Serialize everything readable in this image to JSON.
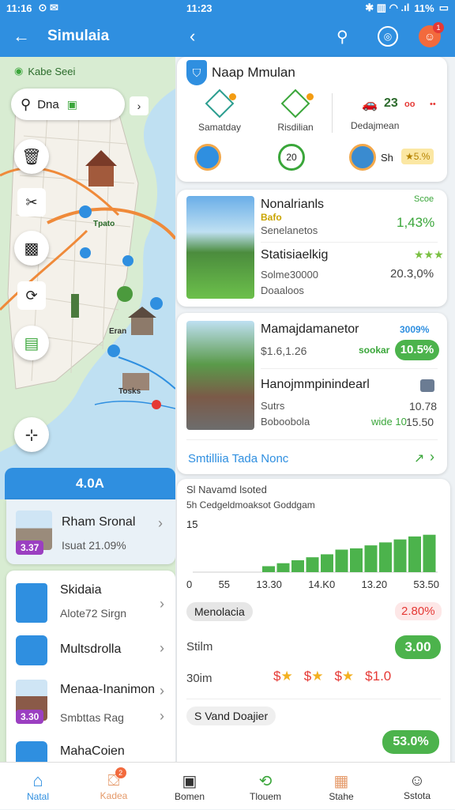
{
  "left": {
    "status_time": "11:16",
    "status_icons": "⊙ ✉",
    "title": "Simulaia",
    "map_label": "Kabe Seei",
    "search_chip": "Dna",
    "search_chip_icon": "▣",
    "map_tags": [
      "Tpato",
      "Eran",
      "Tosks"
    ],
    "banner_value": "4.0A",
    "featured": {
      "title": "Rham Sronal",
      "badge": "3.37",
      "sub": "Isuat  21.09%"
    },
    "list": [
      {
        "title": "Skidaia",
        "sub": "Alote72 Sirgn"
      },
      {
        "title": "Multsdrolla",
        "sub": ""
      },
      {
        "title": "Menaa-Inanimon",
        "sub": "Smbttas Rag",
        "badge": "3.30"
      },
      {
        "title": "MahaCoien",
        "sub": ""
      }
    ]
  },
  "right": {
    "status_time": "11:23",
    "status_icons_right": "✱ ▥ ◠ .ıl",
    "battery": "11%",
    "notif_badge": "1",
    "header_card": {
      "title": "Naap Mmulan",
      "stats": [
        {
          "label": "Samatday"
        },
        {
          "label": "Risdilian"
        },
        {
          "label": "Dedajmean",
          "value": "23",
          "value_suffix": "oo"
        }
      ],
      "chip_value": "20",
      "right_label": "Sh",
      "right_badge": "★5.%"
    },
    "nature_card": {
      "title1": "Nonalrianls",
      "tag": "Bafo",
      "sub1": "Senelanetos",
      "right_small1": "Scoe",
      "right_value1": "1,43%",
      "title2": "Statisiaelkig",
      "right_stars": "★★★",
      "sub2a": "Solme30000",
      "sub2b": "Doaaloos",
      "right_value2": "20.3,0%"
    },
    "route_card": {
      "title1": "Mamajdamanetor",
      "right_small1": "3009%",
      "sub1": "$1.6,1.26",
      "right_tag": "sookar",
      "right_pill": "10.5%",
      "title2": "Hanojmmpinindearl",
      "sub2a": "Sutrs",
      "sub2b": "Boboobola",
      "right_value2a": "10.78",
      "right_value2b_prefix": "wide 10",
      "right_value2b": "15.50",
      "footer": "Smtilliia Tada Nonc",
      "footer_icon": "↗"
    },
    "chart_card": {
      "head1": "Sl Navamd lsoted",
      "head2": "5h Cedgeldmoaksot Goddgam",
      "y_tick": "15",
      "x_ticks": [
        "0",
        "55",
        "13.30",
        "14.K0",
        "13.20",
        "53.50"
      ],
      "chip": "Menolacia",
      "chip_value": "2.80%",
      "row1_label": "Stilm",
      "row1_pill": "3.00",
      "row2_label": "30im",
      "row2_values": [
        "$",
        "$",
        "$",
        "$1.0"
      ],
      "detail_chip": "S Vand Doajier",
      "detail_pill": "53.0%"
    },
    "chart_data": {
      "type": "bar",
      "values": [
        1.4,
        2.1,
        2.8,
        3.5,
        4.2,
        5.3,
        5.6,
        6.3,
        7.0,
        7.7,
        8.4,
        8.8,
        9.9,
        11.7,
        15.8
      ]
    }
  },
  "nav": [
    {
      "label": "Natal",
      "icon": "home-icon"
    },
    {
      "label": "Kadea",
      "icon": "tag-icon",
      "badge": "2"
    },
    {
      "label": "Bomen",
      "icon": "printer-icon"
    },
    {
      "label": "Tlouem",
      "icon": "refresh-icon"
    },
    {
      "label": "Stahe",
      "icon": "store-icon"
    },
    {
      "label": "Sstota",
      "icon": "user-icon"
    }
  ],
  "colors": {
    "primary": "#2f8fe0",
    "green": "#4cb34c",
    "red": "#e53935",
    "water": "#bfe0f2",
    "land": "#d8ecd2"
  }
}
